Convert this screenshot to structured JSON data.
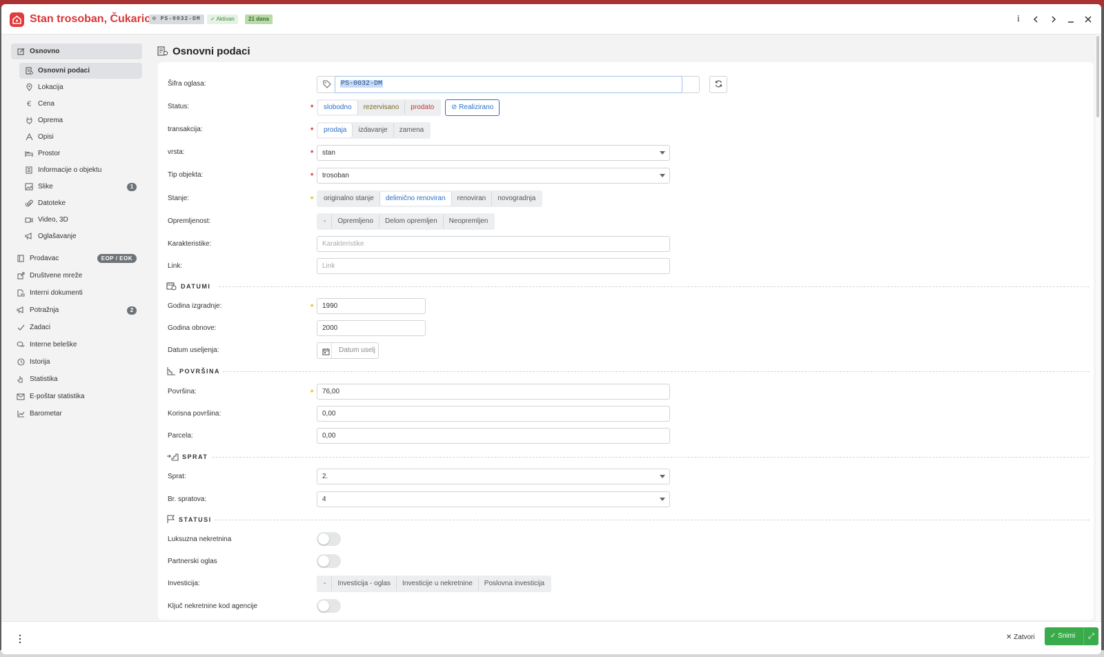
{
  "header": {
    "title": "Stan trosoban, Čukarica",
    "code_badge": "PS-0032-DM",
    "status_badge": "Aktivan",
    "days_badge": "21 dana",
    "info_label": "i"
  },
  "sidebar": {
    "main": {
      "label": "Osnovno"
    },
    "sub_items": [
      {
        "label": "Osnovni podaci"
      },
      {
        "label": "Lokacija"
      },
      {
        "label": "Cena"
      },
      {
        "label": "Oprema"
      },
      {
        "label": "Opisi"
      },
      {
        "label": "Prostor"
      },
      {
        "label": "Informacije o objektu"
      },
      {
        "label": "Slike",
        "count": "1"
      },
      {
        "label": "Datoteke"
      },
      {
        "label": "Video, 3D"
      },
      {
        "label": "Oglašavanje"
      }
    ],
    "items": [
      {
        "label": "Prodavac",
        "tag": "EOP / EOK"
      },
      {
        "label": "Društvene mreže"
      },
      {
        "label": "Interni dokumenti"
      },
      {
        "label": "Potražnja",
        "count": "2"
      },
      {
        "label": "Zadaci"
      },
      {
        "label": "Interne beleške"
      },
      {
        "label": "Istorija"
      },
      {
        "label": "Statistika"
      },
      {
        "label": "E-poštar statistika"
      },
      {
        "label": "Barometar"
      }
    ]
  },
  "main": {
    "title": "Osnovni podaci",
    "sifra": {
      "label": "Šifra oglasa:",
      "value": "PS-0032-DM"
    },
    "status": {
      "label": "Status:",
      "options": [
        "slobodno",
        "rezervisano",
        "prodato"
      ],
      "selected": "slobodno",
      "realized": "Realizirano"
    },
    "transakcija": {
      "label": "transakcija:",
      "options": [
        "prodaja",
        "izdavanje",
        "zamena"
      ],
      "selected": "prodaja"
    },
    "vrsta": {
      "label": "vrsta:",
      "value": "stan"
    },
    "tip": {
      "label": "Tip objekta:",
      "value": "trosoban"
    },
    "stanje": {
      "label": "Stanje:",
      "options": [
        "originalno stanje",
        "delimično renoviran",
        "renoviran",
        "novogradnja"
      ],
      "selected": "delimično renoviran"
    },
    "opremljenost": {
      "label": "Opremljenost:",
      "options": [
        "-",
        "Opremljeno",
        "Delom opremljen",
        "Neopremljen"
      ]
    },
    "karakteristike": {
      "label": "Karakteristike:",
      "placeholder": "Karakteristike"
    },
    "link": {
      "label": "Link:",
      "placeholder": "Link"
    },
    "datumi": {
      "title": "DATUMI",
      "godina_izgradnje": {
        "label": "Godina izgradnje:",
        "value": "1990"
      },
      "godina_obnove": {
        "label": "Godina obnove:",
        "value": "2000"
      },
      "datum_useljenja": {
        "label": "Datum useljenja:",
        "placeholder": "Datum uselj"
      }
    },
    "povrsina": {
      "title": "POVRŠINA",
      "povrsina": {
        "label": "Površina:",
        "value": "76,00"
      },
      "korisna": {
        "label": "Korisna površina:",
        "value": "0,00"
      },
      "parcela": {
        "label": "Parcela:",
        "value": "0,00"
      }
    },
    "sprat": {
      "title": "SPRAT",
      "sprat": {
        "label": "Sprat:",
        "value": "2."
      },
      "br_spratova": {
        "label": "Br. spratova:",
        "value": "4"
      }
    },
    "statusi": {
      "title": "STATUSI",
      "luksuzna": {
        "label": "Luksuzna nekretnina",
        "on": false
      },
      "partnerski": {
        "label": "Partnerski oglas",
        "on": false
      },
      "investicija": {
        "label": "Investicija:",
        "options": [
          "-",
          "Investicija - oglas",
          "Investicije u nekretnine",
          "Poslovna investicija"
        ]
      },
      "kljuc": {
        "label": "Ključ nekretnine kod agencije",
        "on": false
      }
    }
  },
  "footer": {
    "close_label": "Zatvori",
    "save_label": "Snimi"
  },
  "colors": {
    "brand": "#d93535",
    "accent": "#2a6fc7",
    "save": "#3aab4a"
  }
}
